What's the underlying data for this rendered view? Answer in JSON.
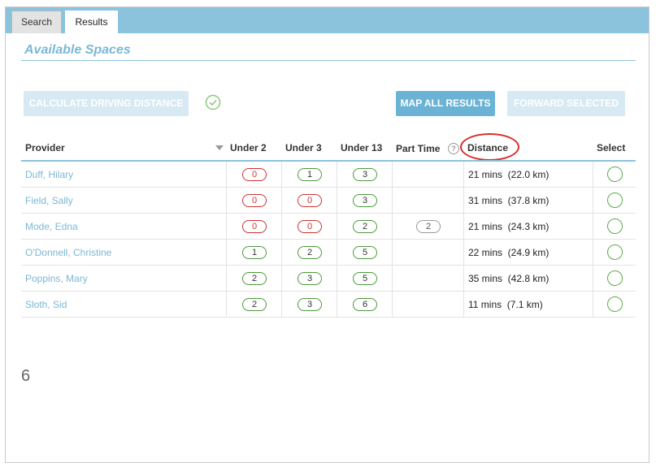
{
  "tabs": [
    {
      "label": "Search"
    },
    {
      "label": "Results"
    }
  ],
  "section_title": "Available Spaces",
  "toolbar": {
    "calc_label": "CALCULATE DRIVING DISTANCE",
    "map_label": "MAP ALL RESULTS",
    "forward_label": "FORWARD SELECTED"
  },
  "headers": {
    "provider": "Provider",
    "under2": "Under 2",
    "under3": "Under 3",
    "under13": "Under 13",
    "part_time": "Part Time",
    "distance": "Distance",
    "select": "Select"
  },
  "rows": [
    {
      "provider": "Duff, Hilary",
      "under2": "0",
      "under3": "1",
      "under13": "3",
      "part_time": "",
      "distance": "21 mins  (22.0 km)"
    },
    {
      "provider": "Field, Sally",
      "under2": "0",
      "under3": "0",
      "under13": "3",
      "part_time": "",
      "distance": "31 mins  (37.8 km)"
    },
    {
      "provider": "Mode, Edna",
      "under2": "0",
      "under3": "0",
      "under13": "2",
      "part_time": "2",
      "distance": "21 mins  (24.3 km)"
    },
    {
      "provider": "O'Donnell, Christine",
      "under2": "1",
      "under3": "2",
      "under13": "5",
      "part_time": "",
      "distance": "22 mins  (24.9 km)"
    },
    {
      "provider": "Poppins, Mary",
      "under2": "2",
      "under3": "3",
      "under13": "5",
      "part_time": "",
      "distance": "35 mins  (42.8 km)"
    },
    {
      "provider": "Sloth, Sid",
      "under2": "2",
      "under3": "3",
      "under13": "6",
      "part_time": "",
      "distance": "11 mins  (7.1 km)"
    }
  ],
  "result_count": "6",
  "colors": {
    "accent": "#8cc3dc",
    "link": "#7ab8d6",
    "zero_pill": "#cc3333",
    "count_pill": "#4a9a3a",
    "annotation": "#d92b2b"
  }
}
